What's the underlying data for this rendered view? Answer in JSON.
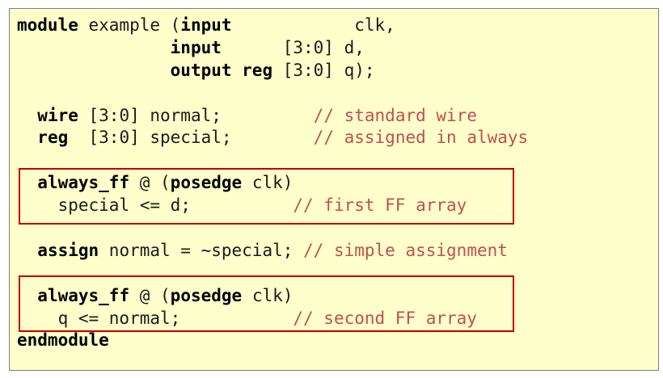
{
  "code": {
    "line1": {
      "kw_module": "module",
      "t1": " example (",
      "kw_input": "input",
      "t2": "            clk,"
    },
    "line2": {
      "indent": "               ",
      "kw_input": "input",
      "t1": "      [3:0] d,"
    },
    "line3": {
      "indent": "               ",
      "kw_output_reg": "output reg",
      "t1": " [3:0] q);"
    },
    "line5": {
      "indent": "  ",
      "kw_wire": "wire",
      "t1": " [3:0] normal;         ",
      "comment": "// standard wire"
    },
    "line6": {
      "indent": "  ",
      "kw_reg": "reg",
      "t1": "  [3:0] special;        ",
      "comment": "// assigned in always"
    },
    "line8": {
      "indent": "  ",
      "kw_always_ff": "always_ff",
      "t1": " @ (",
      "kw_posedge": "posedge",
      "t2": " clk)"
    },
    "line9": {
      "t1": "    special <= d;          ",
      "comment": "// first FF array"
    },
    "line11": {
      "indent": "  ",
      "kw_assign": "assign",
      "t1": " normal = ~special; ",
      "comment": "// simple assignment"
    },
    "line13": {
      "indent": "  ",
      "kw_always_ff": "always_ff",
      "t1": " @ (",
      "kw_posedge": "posedge",
      "t2": " clk)"
    },
    "line14": {
      "t1": "    q <= normal;           ",
      "comment": "// second FF array"
    },
    "line15": {
      "kw_endmodule": "endmodule"
    }
  },
  "colors": {
    "panel_background": "#ffffcc",
    "panel_border": "#7f7f7f",
    "keyword": "#000000",
    "comment": "#c0504d",
    "highlight_box": "#c00000"
  }
}
